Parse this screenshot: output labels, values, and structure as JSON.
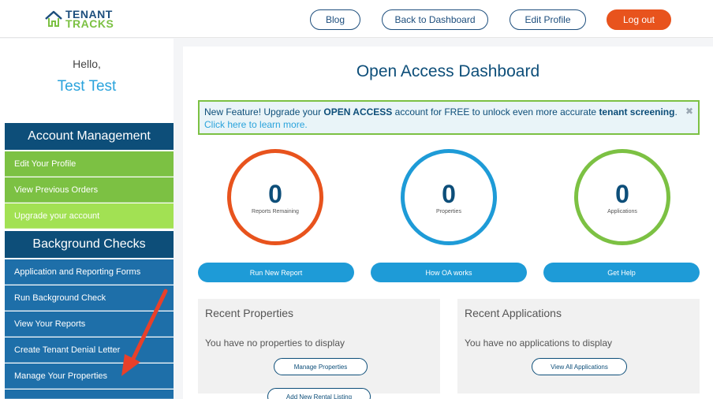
{
  "header": {
    "logo_line1": "TENANT",
    "logo_line2": "TRACKS",
    "blog": "Blog",
    "back": "Back to Dashboard",
    "edit_profile": "Edit Profile",
    "logout": "Log out"
  },
  "sidebar": {
    "hello": "Hello,",
    "username": "Test Test",
    "section1": "Account Management",
    "section2": "Background Checks",
    "items": [
      "Edit Your Profile",
      "View Previous Orders",
      "Upgrade your account",
      "Application and Reporting Forms",
      "Run Background Check",
      "View Your Reports",
      "Create Tenant Denial Letter",
      "Manage Your Properties"
    ]
  },
  "main": {
    "title": "Open Access Dashboard",
    "notice_pre": "New Feature! Upgrade your ",
    "notice_bold1": "OPEN ACCESS",
    "notice_mid": " account for FREE to unlock even more accurate ",
    "notice_bold2": "tenant screening",
    "notice_dot": ". ",
    "notice_link": "Click here to learn more.",
    "stats": [
      {
        "value": "0",
        "label": "Reports Remaining"
      },
      {
        "value": "0",
        "label": "Properties"
      },
      {
        "value": "0",
        "label": "Applications"
      }
    ],
    "buttons": [
      "Run New Report",
      "How OA works",
      "Get Help"
    ],
    "recent_properties": {
      "title": "Recent Properties",
      "empty": "You have no properties to display",
      "btn1": "Manage Properties",
      "btn2": "Add New Rental Listing"
    },
    "recent_applications": {
      "title": "Recent Applications",
      "empty": "You have no applications to display",
      "btn1": "View All Applications"
    }
  },
  "colors": {
    "navy": "#0d4e79",
    "green": "#7cc143",
    "orange": "#e8531d",
    "blue": "#1e9bd7"
  }
}
